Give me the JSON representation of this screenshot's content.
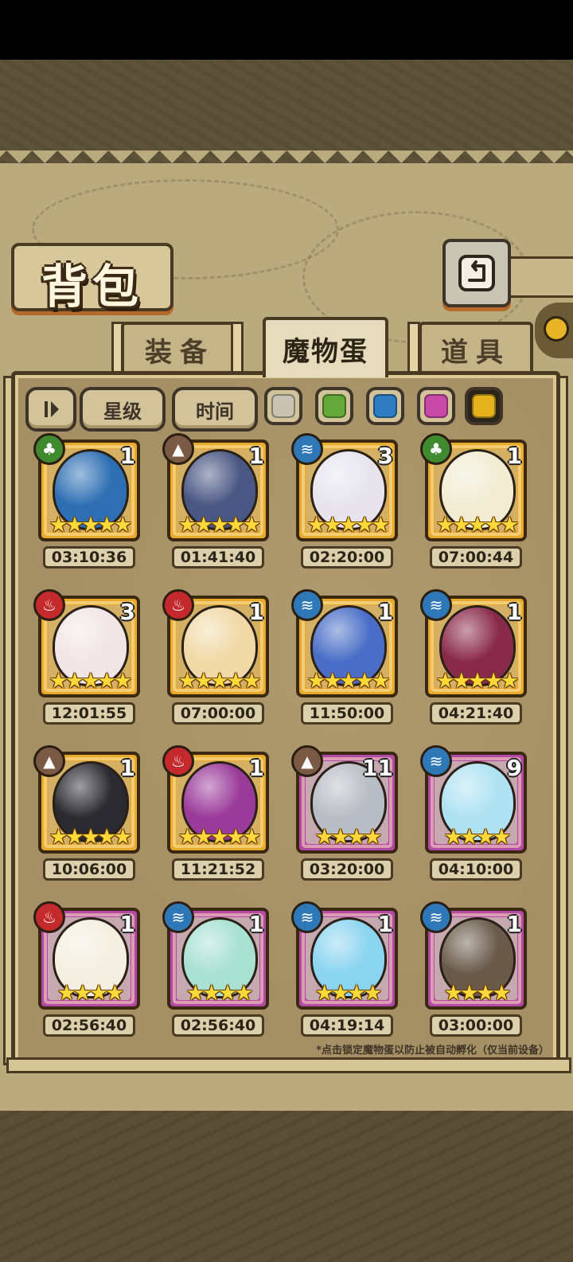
{
  "header": {
    "title": "背包"
  },
  "tabs": [
    {
      "label": "装备",
      "active": false
    },
    {
      "label": "魔物蛋",
      "active": true
    },
    {
      "label": "道具",
      "active": false
    }
  ],
  "filters": {
    "sort_icon": "sort-toggle-icon",
    "star_label": "星级",
    "time_label": "时间",
    "swatches": [
      "#c9c2b2",
      "#62a83a",
      "#2f7cc0",
      "#c94aa8",
      "#e3b21c"
    ],
    "selected_swatch": 4
  },
  "eggs": [
    {
      "element": "grass",
      "count": "1",
      "stars": 5,
      "rarity": "gold",
      "timer": "03:10:36",
      "color": "#2e6fb3"
    },
    {
      "element": "earth",
      "count": "1",
      "stars": 5,
      "rarity": "gold",
      "timer": "01:41:40",
      "color": "#4a5784"
    },
    {
      "element": "water",
      "count": "3",
      "stars": 5,
      "rarity": "gold",
      "timer": "02:20:00",
      "color": "#e7e4ee"
    },
    {
      "element": "grass",
      "count": "1",
      "stars": 5,
      "rarity": "gold",
      "timer": "07:00:44",
      "color": "#f1ecd2"
    },
    {
      "element": "fire",
      "count": "3",
      "stars": 5,
      "rarity": "gold",
      "timer": "12:01:55",
      "color": "#f2e5e5"
    },
    {
      "element": "fire",
      "count": "1",
      "stars": 5,
      "rarity": "gold",
      "timer": "07:00:00",
      "color": "#f1d9a7"
    },
    {
      "element": "water",
      "count": "1",
      "stars": 5,
      "rarity": "gold",
      "timer": "11:50:00",
      "color": "#4a6ec7"
    },
    {
      "element": "water",
      "count": "1",
      "stars": 5,
      "rarity": "gold",
      "timer": "04:21:40",
      "color": "#8a2a4a"
    },
    {
      "element": "earth",
      "count": "1",
      "stars": 5,
      "rarity": "gold",
      "timer": "10:06:00",
      "color": "#2a2a30"
    },
    {
      "element": "fire",
      "count": "1",
      "stars": 5,
      "rarity": "gold",
      "timer": "11:21:52",
      "color": "#9a3a9a"
    },
    {
      "element": "earth",
      "count": "11",
      "stars": 4,
      "rarity": "purple",
      "timer": "03:20:00",
      "color": "#b8bcc4"
    },
    {
      "element": "water",
      "count": "9",
      "stars": 4,
      "rarity": "purple",
      "timer": "04:10:00",
      "color": "#aee2f2"
    },
    {
      "element": "fire",
      "count": "1",
      "stars": 4,
      "rarity": "purple",
      "timer": "02:56:40",
      "color": "#f4efe0"
    },
    {
      "element": "water",
      "count": "1",
      "stars": 4,
      "rarity": "purple",
      "timer": "02:56:40",
      "color": "#a8e0d2"
    },
    {
      "element": "water",
      "count": "1",
      "stars": 4,
      "rarity": "purple",
      "timer": "04:19:14",
      "color": "#8ad4f0"
    },
    {
      "element": "water",
      "count": "1",
      "stars": 4,
      "rarity": "purple",
      "timer": "03:00:00",
      "color": "#6a5a4a"
    }
  ],
  "hint": "*点击锁定魔物蛋以防止被自动孵化（仅当前设备）",
  "icons": {
    "back": "return-arrow-icon",
    "element_symbols": {
      "grass": "♣",
      "earth": "▲",
      "water": "≋",
      "fire": "♨"
    }
  }
}
